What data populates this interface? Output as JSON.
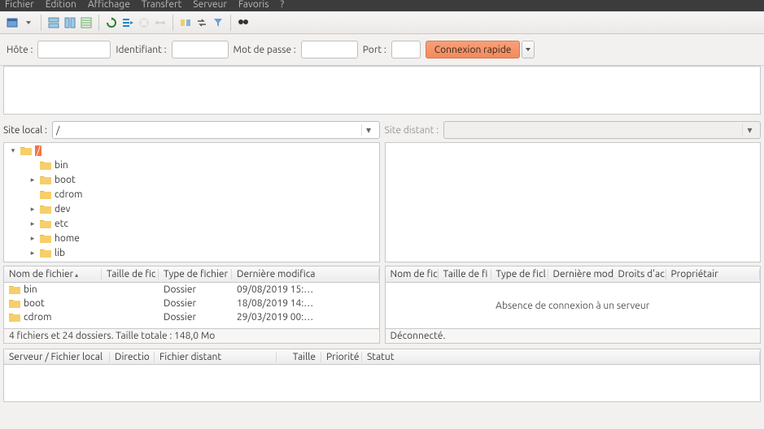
{
  "menu": {
    "items": [
      "Fichier",
      "Édition",
      "Affichage",
      "Transfert",
      "Serveur",
      "Favoris",
      "?"
    ]
  },
  "quick": {
    "host_label": "Hôte :",
    "user_label": "Identifiant :",
    "pass_label": "Mot de passe :",
    "port_label": "Port :",
    "connect_label": "Connexion rapide"
  },
  "local": {
    "path_label": "Site local :",
    "path_value": "/",
    "tree": [
      {
        "name": "/",
        "depth": 0,
        "exp": "▾",
        "sel": true
      },
      {
        "name": "bin",
        "depth": 1,
        "exp": ""
      },
      {
        "name": "boot",
        "depth": 1,
        "exp": "▸"
      },
      {
        "name": "cdrom",
        "depth": 1,
        "exp": ""
      },
      {
        "name": "dev",
        "depth": 1,
        "exp": "▸"
      },
      {
        "name": "etc",
        "depth": 1,
        "exp": "▸"
      },
      {
        "name": "home",
        "depth": 1,
        "exp": "▸"
      },
      {
        "name": "lib",
        "depth": 1,
        "exp": "▸"
      }
    ],
    "columns": [
      "Nom de fichier",
      "Taille de fic",
      "Type de fichier",
      "Dernière modifica"
    ],
    "rows": [
      {
        "name": "bin",
        "size": "",
        "type": "Dossier",
        "date": "09/08/2019 15:…"
      },
      {
        "name": "boot",
        "size": "",
        "type": "Dossier",
        "date": "18/08/2019 14:…"
      },
      {
        "name": "cdrom",
        "size": "",
        "type": "Dossier",
        "date": "29/03/2019 00:…"
      }
    ],
    "status": "4 fichiers et 24 dossiers. Taille totale : 148,0 Mo"
  },
  "remote": {
    "path_label": "Site distant :",
    "columns": [
      "Nom de fic",
      "Taille de fi",
      "Type de ficl",
      "Dernière modi",
      "Droits d'ac",
      "Propriétair"
    ],
    "empty_msg": "Absence de connexion à un serveur",
    "status": "Déconnecté."
  },
  "queue": {
    "columns": [
      "Serveur / Fichier local",
      "Directio",
      "Fichier distant",
      "Taille",
      "Priorité",
      "Statut"
    ]
  }
}
